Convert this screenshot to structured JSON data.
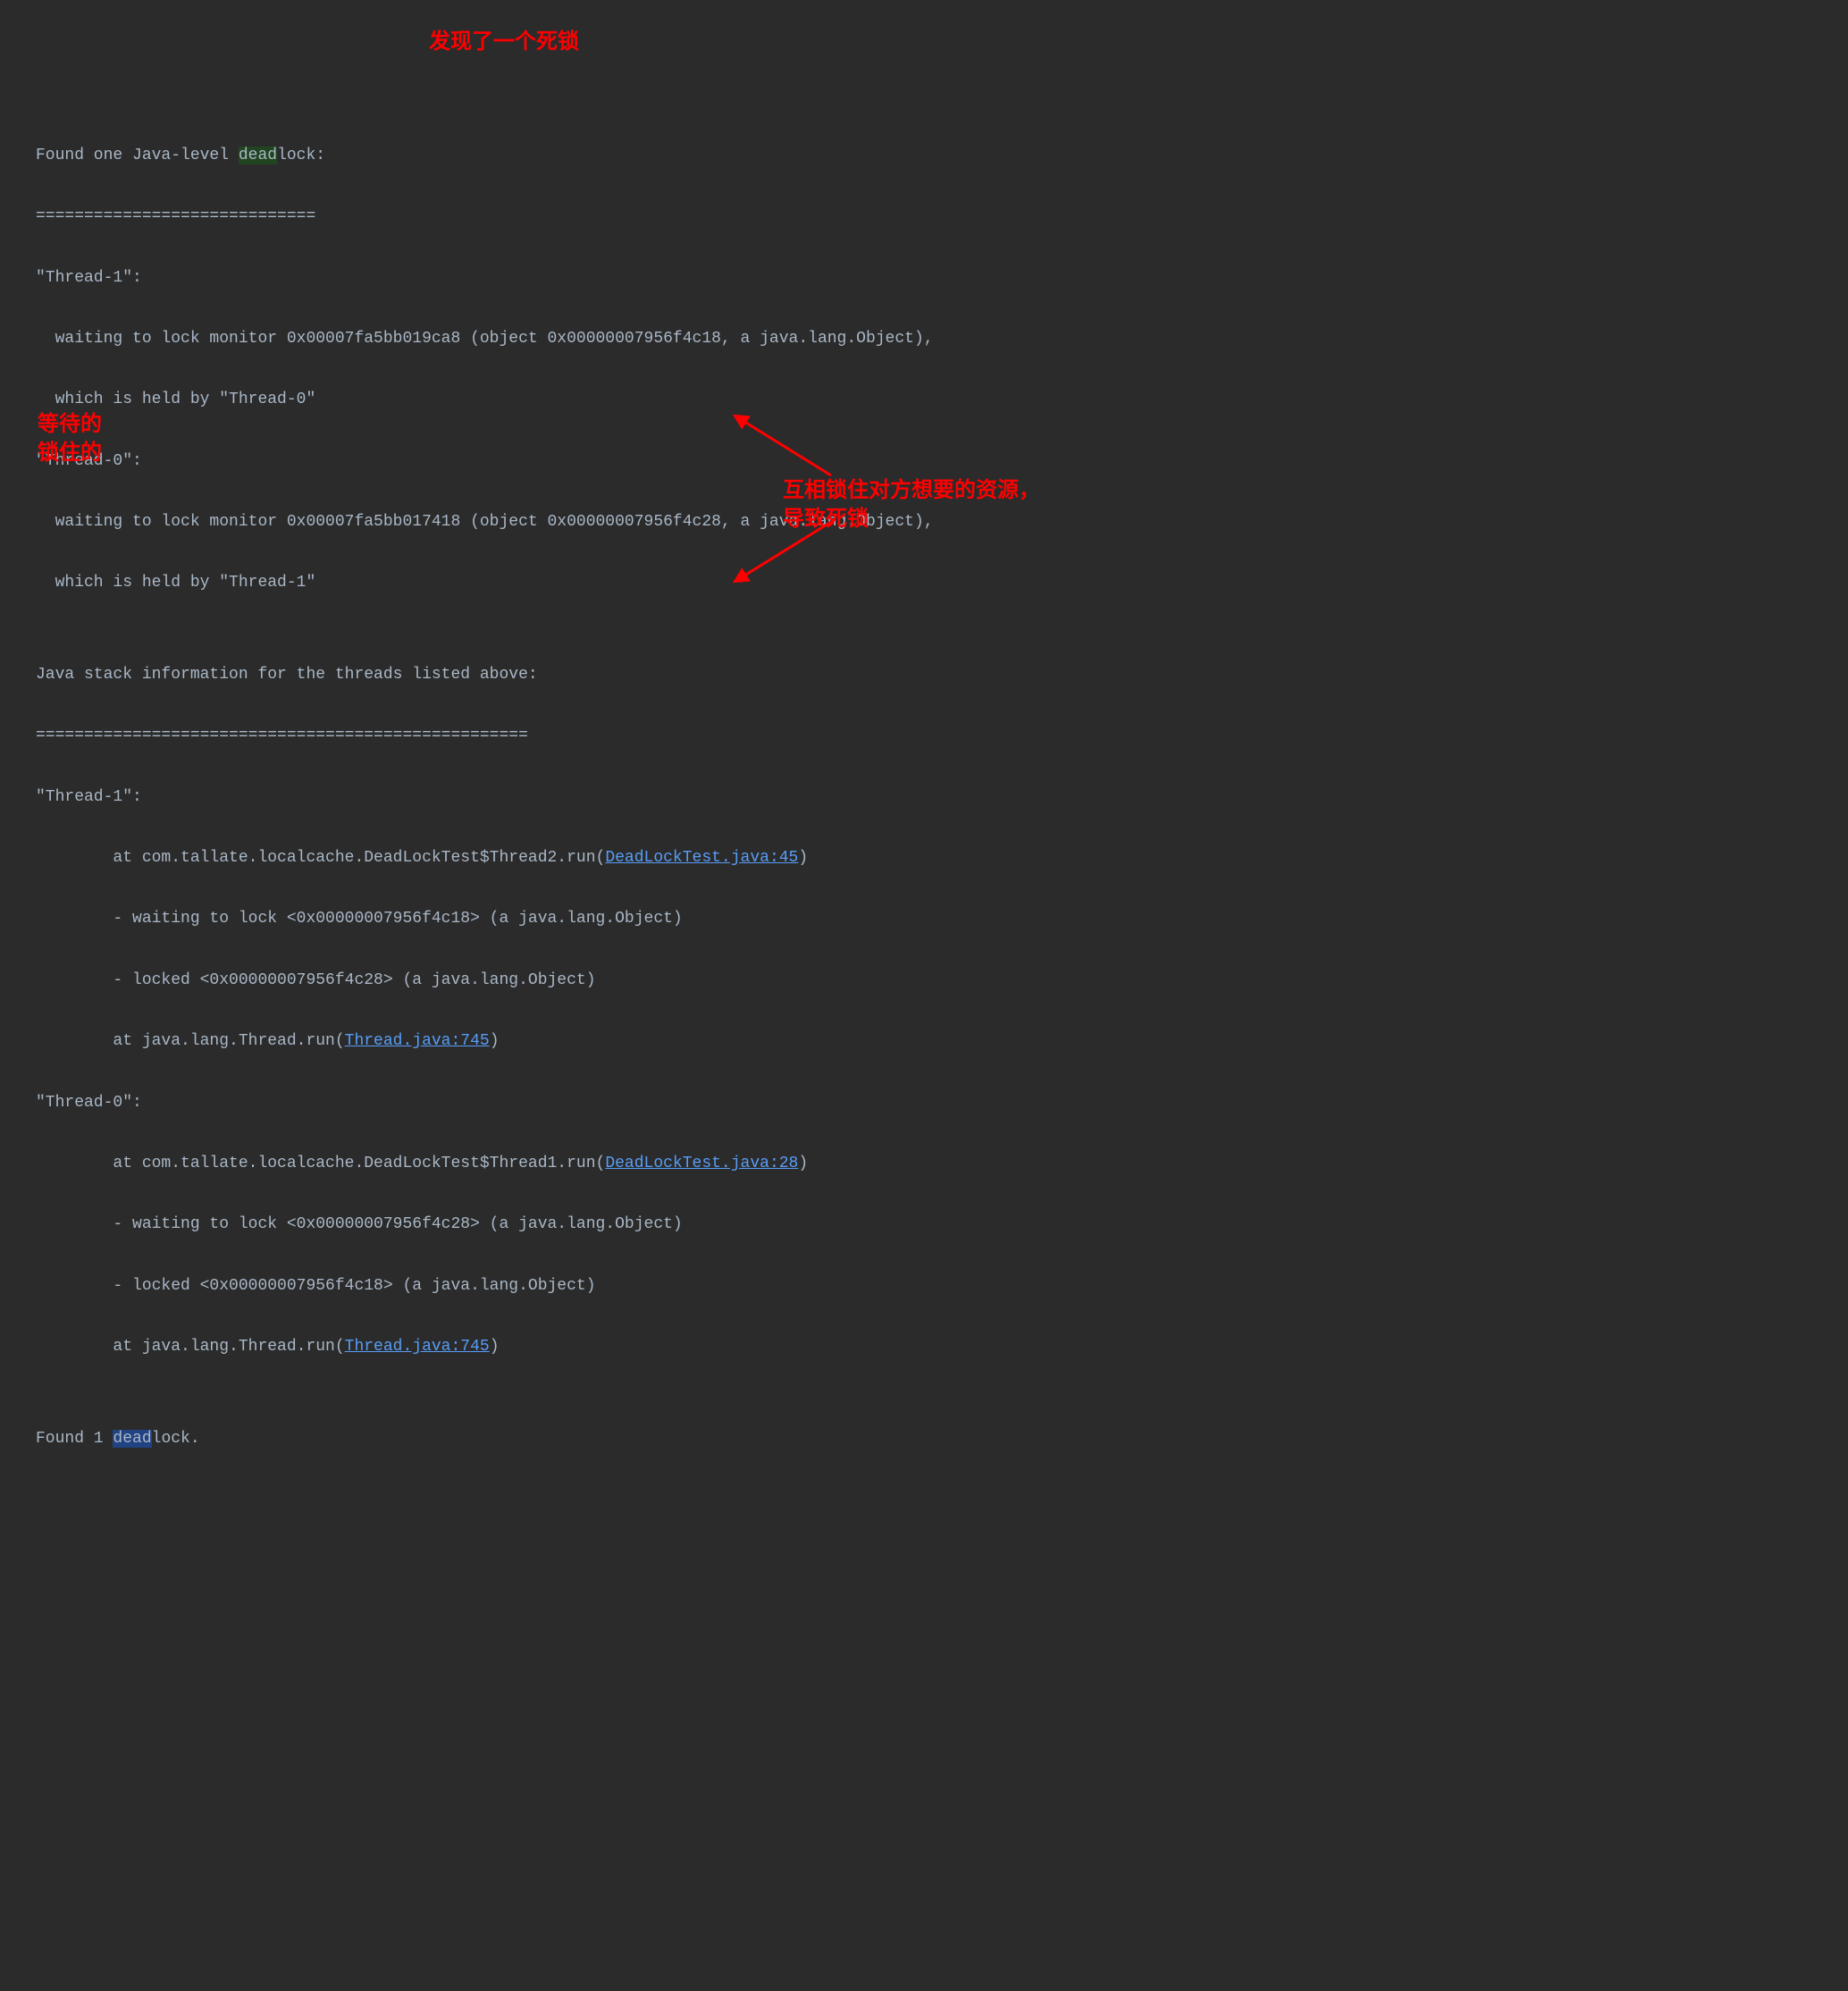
{
  "line1_a": "Found one Java-level ",
  "line1_b": "dead",
  "line1_c": "lock:",
  "line2": "=============================",
  "line3": "\"Thread-1\":",
  "line4": "  waiting to lock monitor 0x00007fa5bb019ca8 (object 0x00000007956f4c18, a java.lang.Object),",
  "line5": "  which is held by \"Thread-0\"",
  "line6": "\"Thread-0\":",
  "line7": "  waiting to lock monitor 0x00007fa5bb017418 (object 0x00000007956f4c28, a java.lang.Object),",
  "line8": "  which is held by \"Thread-1\"",
  "line9": "",
  "line10": "Java stack information for the threads listed above:",
  "line11": "===================================================",
  "line12": "\"Thread-1\":",
  "line13_a": "        at com.tallate.localcache.DeadLockTest$Thread2.run(",
  "line13_link": "DeadLockTest.java:45",
  "line13_b": ")",
  "line14": "        - waiting to lock <0x00000007956f4c18> (a java.lang.Object)",
  "line15": "        - locked <0x00000007956f4c28> (a java.lang.Object)",
  "line16_a": "        at java.lang.Thread.run(",
  "line16_link": "Thread.java:745",
  "line16_b": ")",
  "line17": "\"Thread-0\":",
  "line18_a": "        at com.tallate.localcache.DeadLockTest$Thread1.run(",
  "line18_link": "DeadLockTest.java:28",
  "line18_b": ")",
  "line19": "        - waiting to lock <0x00000007956f4c28> (a java.lang.Object)",
  "line20": "        - locked <0x00000007956f4c18> (a java.lang.Object)",
  "line21_a": "        at java.lang.Thread.run(",
  "line21_link": "Thread.java:745",
  "line21_b": ")",
  "line22": "",
  "line23_a": "Found 1 ",
  "line23_b": "dead",
  "line23_c": "lock.",
  "annotations": {
    "found_deadlock": "发现了一个死锁",
    "waiting": "等待的",
    "locked": "锁住的",
    "mutual_lock_1": "互相锁住对方想要的资源，",
    "mutual_lock_2": "导致死锁"
  }
}
